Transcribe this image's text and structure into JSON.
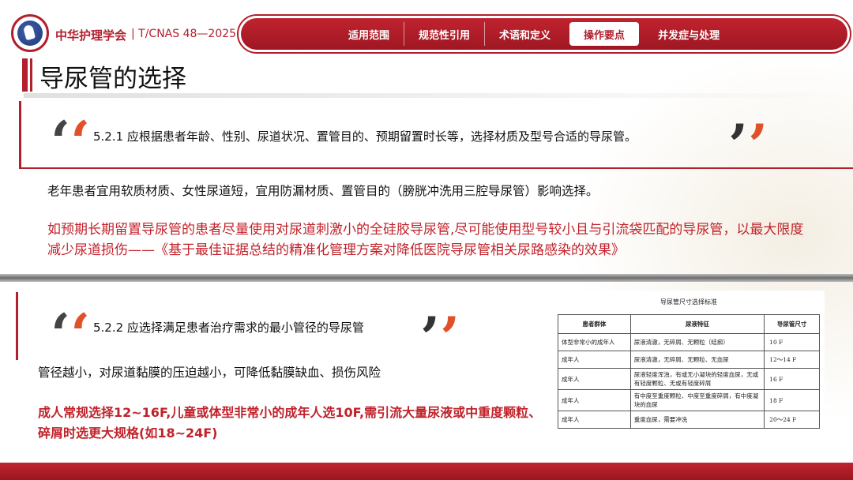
{
  "header": {
    "org_name": "中华护理学会",
    "std_code": "| T/CNAS 48—2025",
    "nav": [
      {
        "label": "适用范围",
        "active": false
      },
      {
        "label": "规范性引用",
        "active": false
      },
      {
        "label": "术语和定义",
        "active": false
      },
      {
        "label": "操作要点",
        "active": true
      },
      {
        "label": "并发症与处理",
        "active": false
      }
    ]
  },
  "page": {
    "title": "导尿管的选择"
  },
  "section1": {
    "quote": "5.2.1 应根据患者年龄、性别、尿道状况、置管目的、预期留置时长等，选择材质及型号合适的导尿管。",
    "para1": "老年患者宜用软质材质、女性尿道短，宜用防漏材质、置管目的（膀胱冲洗用三腔导尿管）影响选择。",
    "para2": "如预期长期留置导尿管的患者尽量使用对尿道刺激小的全硅胶导尿管,尽可能使用型号较小且与引流袋匹配的导尿管，以最大限度减少尿道损伤——《基于最佳证据总结的精准化管理方案对降低医院导尿管相关尿路感染的效果》"
  },
  "section2": {
    "quote": "5.2.2 应选择满足患者治疗需求的最小管径的导尿管",
    "para1": "管径越小，对尿道黏膜的压迫越小，可降低黏膜缺血、损伤风险",
    "para2": "成人常规选择12~16F,儿童或体型非常小的成年人选10F,需引流大量尿液或中重度颗粒、碎屑时选更大规格(如18~24F)"
  },
  "table": {
    "title": "导尿管尺寸选择标准",
    "headers": [
      "患者群体",
      "尿液特征",
      "导尿管尺寸"
    ],
    "rows": [
      [
        "体型非常小的成年人",
        "尿液清澈，无碎屑、无颗粒（结痂）",
        "10 F"
      ],
      [
        "成年人",
        "尿液清澈，无碎屑、无颗粒、无血尿",
        "12～14 F"
      ],
      [
        "成年人",
        "尿液轻度浑浊，有或无小凝块的轻度血尿，无或有轻度颗粒、无或有轻度碎屑",
        "16 F"
      ],
      [
        "成年人",
        "有中度至重度颗粒、中度至重度碎屑，有中度凝块的血尿",
        "18 F"
      ],
      [
        "成年人",
        "重度血尿，需要冲洗",
        "20～24 F"
      ]
    ]
  },
  "colors": {
    "brand_red": "#b21f2d",
    "accent_orange": "#e0512a",
    "highlight_red": "#c0222a"
  }
}
